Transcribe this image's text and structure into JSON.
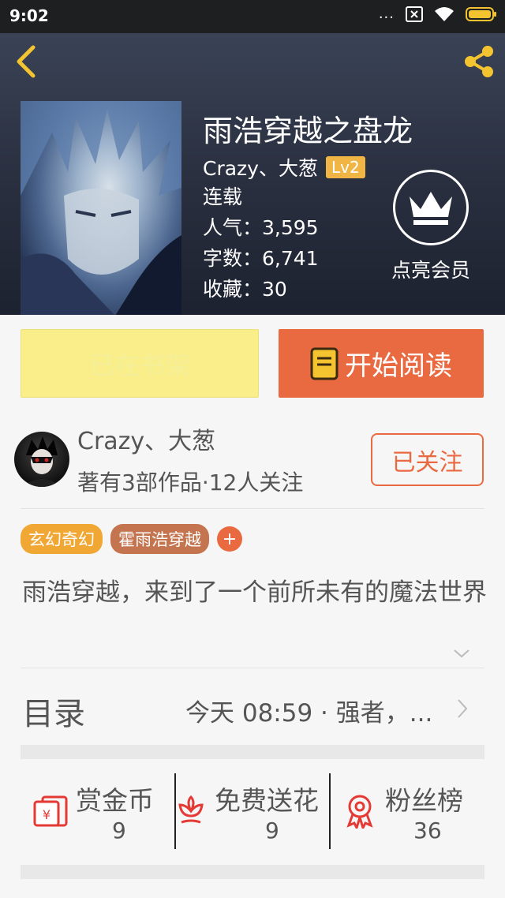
{
  "status_bar": {
    "time": "9:02",
    "dots": "..."
  },
  "book": {
    "title": "雨浩穿越之盘龙",
    "author": "Crazy、大葱",
    "level": "Lv2",
    "status": "连载",
    "popularity": "人气：3,595",
    "word_count": "字数：6,741",
    "favorites": "收藏：30"
  },
  "vip": {
    "label": "点亮会员"
  },
  "actions": {
    "shelf_label": "已在书架",
    "read_label": "开始阅读"
  },
  "author_card": {
    "name": "Crazy、大葱",
    "stats": "著有3部作品·12人关注",
    "follow_label": "已关注"
  },
  "tags": [
    "玄幻奇幻",
    "霍雨浩穿越"
  ],
  "tag_add": "+",
  "description": "雨浩穿越，来到了一个前所未有的魔法世界",
  "catalog": {
    "label": "目录",
    "latest": "今天 08:59 · 强者，..."
  },
  "stats": [
    {
      "label": "赏金币",
      "value": "9",
      "icon": "red-envelope-icon"
    },
    {
      "label": "免费送花",
      "value": "9",
      "icon": "flower-icon"
    },
    {
      "label": "粉丝榜",
      "value": "36",
      "icon": "medal-icon"
    }
  ],
  "colors": {
    "accent": "#e96a40",
    "shelf_button": "#f9ee89",
    "level_badge": "#f1b546",
    "icon_yellow": "#f4c430"
  }
}
